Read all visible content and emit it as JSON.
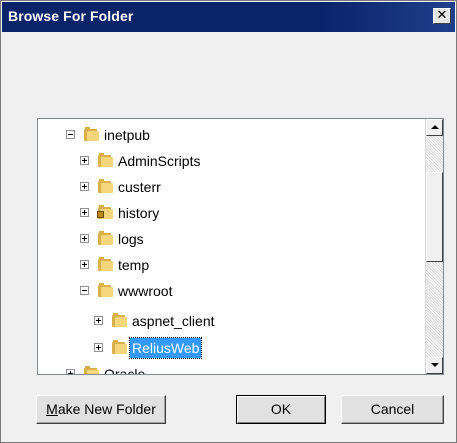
{
  "dialog": {
    "title": "Browse For Folder",
    "close_glyph": "✕"
  },
  "tree": {
    "nodes": [
      {
        "label": "inetpub",
        "expander": "minus",
        "locked": false,
        "selected": false
      },
      {
        "label": "AdminScripts",
        "expander": "plus",
        "locked": false,
        "selected": false
      },
      {
        "label": "custerr",
        "expander": "plus",
        "locked": false,
        "selected": false
      },
      {
        "label": "history",
        "expander": "plus",
        "locked": true,
        "selected": false
      },
      {
        "label": "logs",
        "expander": "plus",
        "locked": false,
        "selected": false
      },
      {
        "label": "temp",
        "expander": "plus",
        "locked": false,
        "selected": false
      },
      {
        "label": "wwwroot",
        "expander": "minus",
        "locked": false,
        "selected": false
      },
      {
        "label": "aspnet_client",
        "expander": "plus",
        "locked": false,
        "selected": false
      },
      {
        "label": "ReliusWeb",
        "expander": "plus",
        "locked": false,
        "selected": true
      },
      {
        "label": "Oracle",
        "expander": "plus",
        "locked": false,
        "selected": false
      }
    ]
  },
  "buttons": {
    "make_new_folder_mnemonic": "M",
    "make_new_folder_rest": "ake New Folder",
    "ok": "OK",
    "cancel": "Cancel"
  },
  "icons": {
    "folder": "folder-icon",
    "locked_folder": "locked-folder-icon",
    "expand": "expand-icon",
    "collapse": "collapse-icon"
  }
}
